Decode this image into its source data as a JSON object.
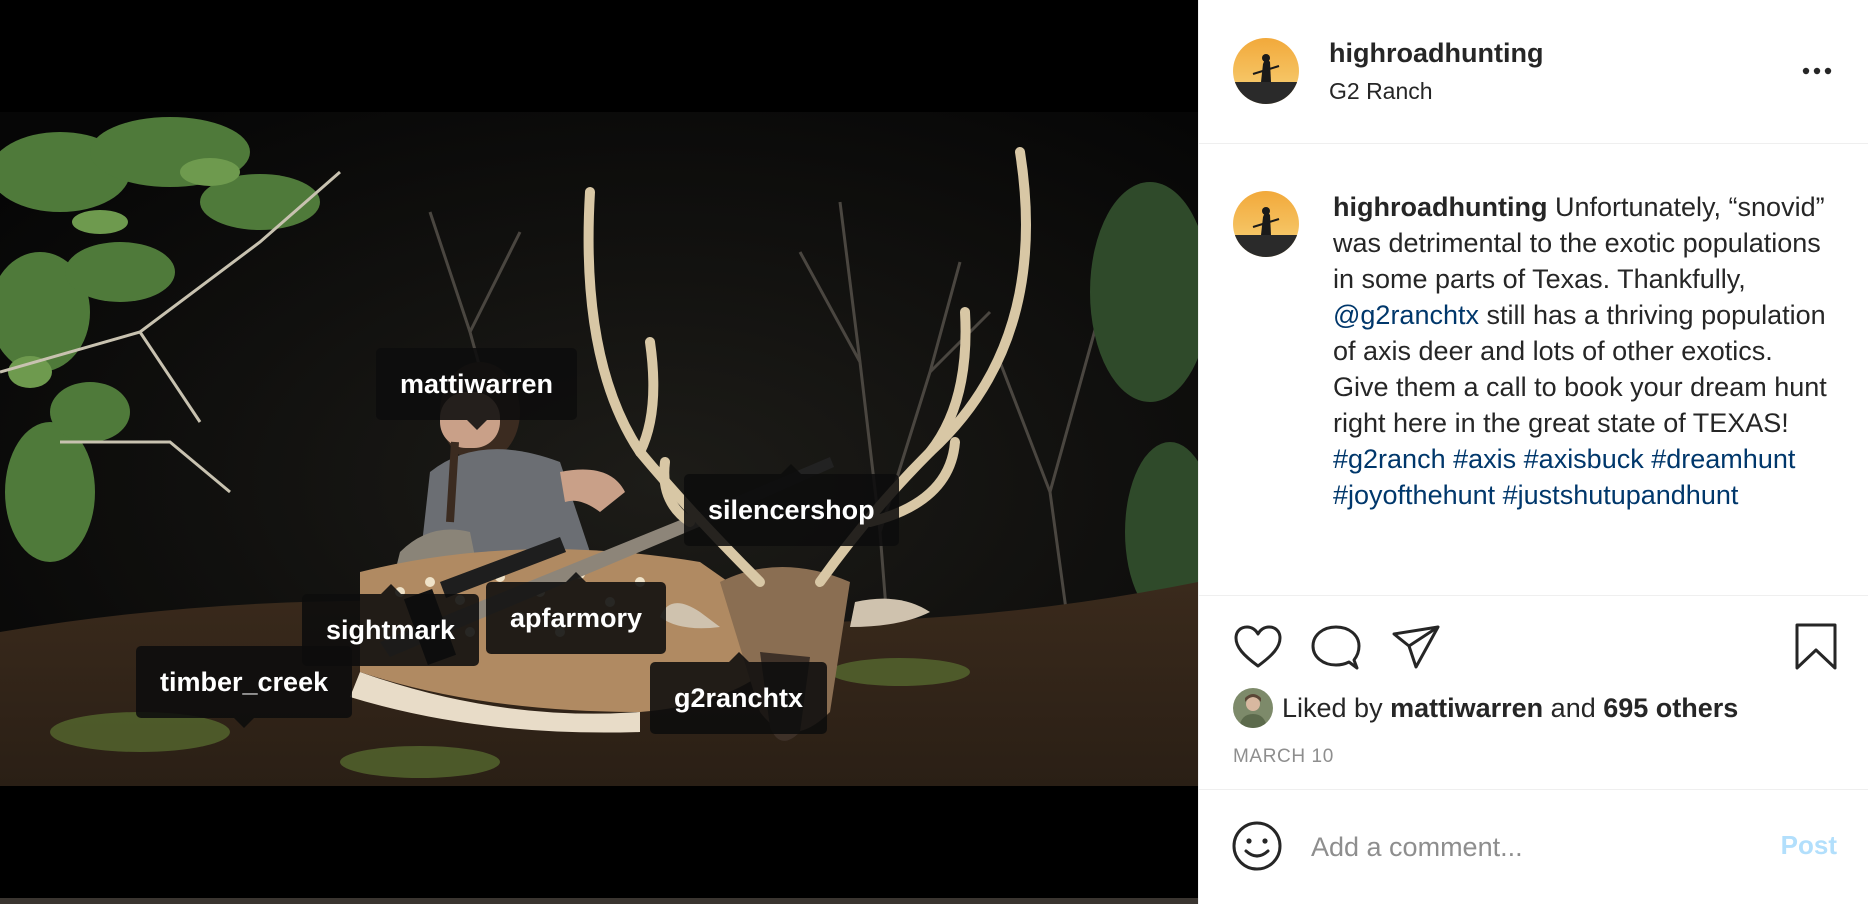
{
  "post": {
    "username": "highroadhunting",
    "location": "G2 Ranch",
    "caption": {
      "username": "highroadhunting",
      "text_1": " Unfortunately, “snovid” was detrimental to the exotic populations in some parts of Texas. Thankfully, ",
      "mention": "@g2ranchtx",
      "text_2": " still has a thriving population of axis deer and lots of other exotics. Give them a call to book your dream hunt right here in the great state of TEXAS! ",
      "hashtags": [
        "#g2ranch",
        "#axis",
        "#axisbuck",
        "#dreamhunt",
        "#joyofthehunt",
        "#justshutupandhunt"
      ]
    },
    "likes": {
      "prefix": "Liked by",
      "user": "mattiwarren",
      "conjunction": "and",
      "others": "695 others"
    },
    "date": "MARCH 10"
  },
  "photo_tags": [
    {
      "label": "mattiwarren"
    },
    {
      "label": "silencershop"
    },
    {
      "label": "sightmark"
    },
    {
      "label": "apfarmory"
    },
    {
      "label": "timber_creek"
    },
    {
      "label": "g2ranchtx"
    }
  ],
  "icons": {
    "more": "more-options-icon",
    "like": "heart-icon",
    "comment": "comment-icon",
    "share": "paper-plane-icon",
    "save": "bookmark-icon",
    "emoji": "smiley-icon",
    "user_tags": "user-icon"
  },
  "comment_box": {
    "placeholder": "Add a comment...",
    "post_label": "Post"
  },
  "colors": {
    "link": "#00376b",
    "text": "#262626",
    "secondary": "#8e8e8e",
    "post_disabled": "#b2dffc"
  }
}
